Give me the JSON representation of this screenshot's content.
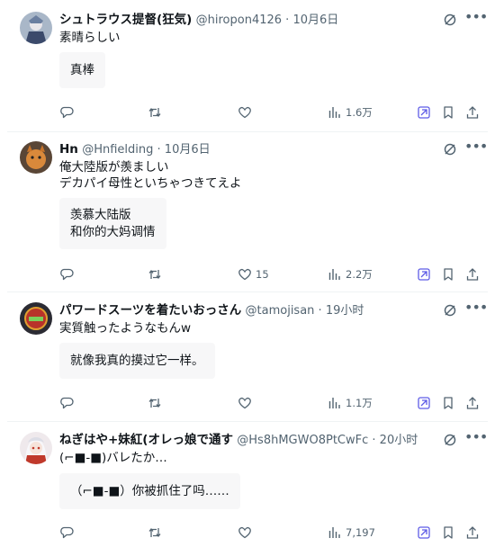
{
  "tweets": [
    {
      "name": "シュトラウス提督(狂気)",
      "handle": "@hiropon4126",
      "time": "10月6日",
      "text_lines": [
        "素晴らしい"
      ],
      "translation_lines": [
        "真棒"
      ],
      "likes": "",
      "views": "1.6万"
    },
    {
      "name": "Hn",
      "handle": "@Hnfielding",
      "time": "10月6日",
      "text_lines": [
        "俺大陸版が羨ましい",
        "デカパイ母性といちゃつきてえよ"
      ],
      "translation_lines": [
        "羡慕大陆版",
        "和你的大妈调情"
      ],
      "likes": "15",
      "views": "2.2万"
    },
    {
      "name": "パワードスーツを着たいおっさん",
      "handle": "@tamojisan",
      "time": "19小时",
      "text_lines": [
        "実質触ったようなもんw"
      ],
      "translation_lines": [
        "就像我真的摸过它一样。"
      ],
      "likes": "",
      "views": "1.1万"
    },
    {
      "name": "ねぎはや+妹紅(オレっ娘で通す",
      "handle": "@Hs8hMGWO8PtCwFc",
      "time": "20小时",
      "text_lines": [
        "(⌐■-■)バレたか…"
      ],
      "translation_lines": [
        "（⌐■-■）你被抓住了吗……"
      ],
      "likes": "",
      "views": "7,197"
    }
  ],
  "separator": " · ",
  "icons": {
    "reply": "reply-icon",
    "retweet": "retweet-icon",
    "like": "heart-icon",
    "views": "views-icon",
    "grok": "grok-icon",
    "bookmark": "bookmark-icon",
    "share": "share-icon",
    "more": "more-icon"
  },
  "colors": {
    "accent": "#5e5ce6",
    "muted": "#536471",
    "text": "#0f1419",
    "box": "#f7f7f8"
  }
}
